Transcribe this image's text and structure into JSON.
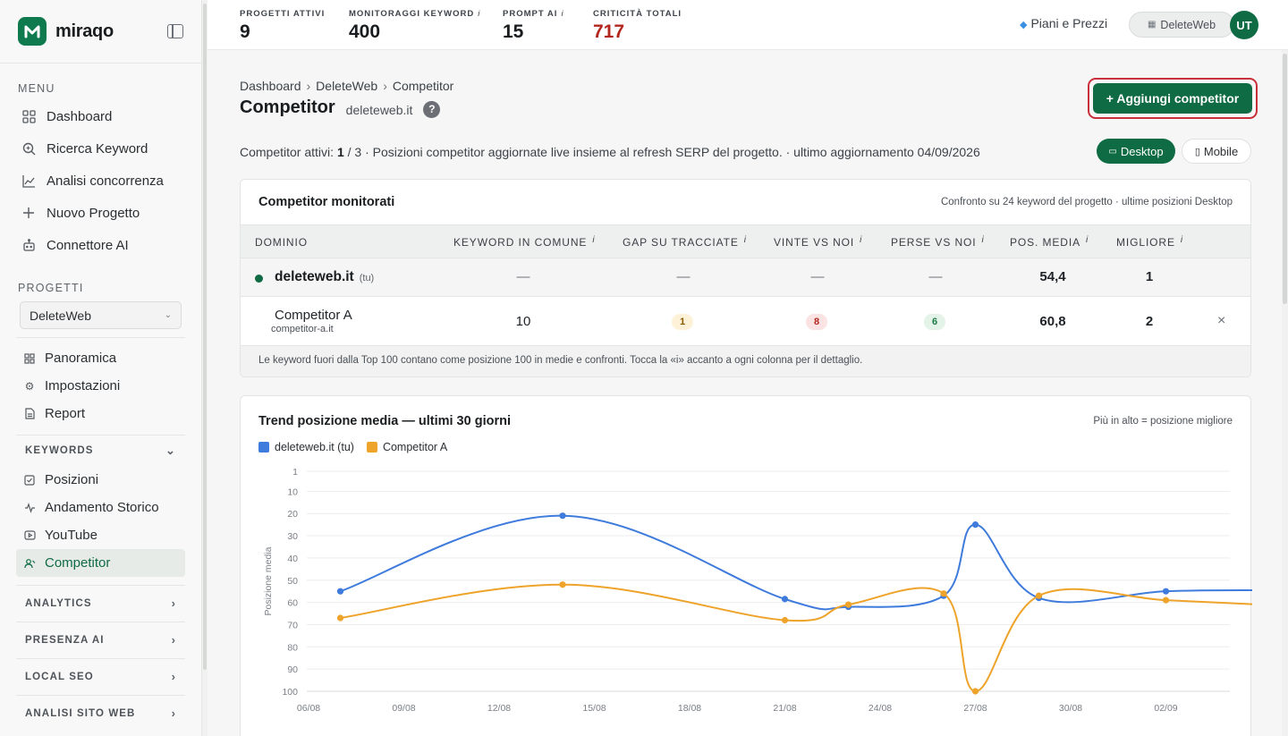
{
  "brand": {
    "name": "miraqo",
    "logo_letter": "M"
  },
  "sidebar": {
    "menu_label": "MENU",
    "menu_items": [
      {
        "label": "Dashboard",
        "icon": "grid-icon"
      },
      {
        "label": "Ricerca Keyword",
        "icon": "search-icon"
      },
      {
        "label": "Analisi concorrenza",
        "icon": "trend-icon"
      },
      {
        "label": "Nuovo Progetto",
        "icon": "plus-icon"
      },
      {
        "label": "Connettore AI",
        "icon": "robot-icon"
      }
    ],
    "projects_label": "PROGETTI",
    "project_select": "DeleteWeb",
    "project_items": [
      {
        "label": "Panoramica",
        "icon": "grid-small-icon"
      },
      {
        "label": "Impostazioni",
        "icon": "gear-icon"
      },
      {
        "label": "Report",
        "icon": "document-icon"
      }
    ],
    "keywords_group": "KEYWORDS",
    "keyword_items": [
      {
        "label": "Posizioni",
        "icon": "checkbox-icon"
      },
      {
        "label": "Andamento Storico",
        "icon": "pulse-icon"
      },
      {
        "label": "YouTube",
        "icon": "youtube-icon"
      },
      {
        "label": "Competitor",
        "icon": "users-icon",
        "active": true
      }
    ],
    "groups": [
      "ANALYTICS",
      "PRESENZA AI",
      "LOCAL SEO",
      "ANALISI SITO WEB"
    ]
  },
  "topbar": {
    "stats": [
      {
        "label": "PROGETTI ATTIVI",
        "value": "9",
        "info": false
      },
      {
        "label": "MONITORAGGI KEYWORD",
        "value": "400",
        "info": true
      },
      {
        "label": "PROMPT AI",
        "value": "15",
        "info": true
      },
      {
        "label": "CRITICITÀ TOTALI",
        "value": "717",
        "info": false
      }
    ],
    "info_glyph": "i",
    "pricing": "Piani e Prezzi",
    "workspace": "DeleteWeb",
    "avatar": "UT"
  },
  "page": {
    "breadcrumb": [
      "Dashboard",
      "DeleteWeb",
      "Competitor"
    ],
    "title": "Competitor",
    "domain": "deleteweb.it",
    "help": "?",
    "add_button": "+ Aggiungi competitor",
    "info_prefix": "Competitor attivi: ",
    "info_active": "1",
    "info_suffix": " / 3 · Posizioni competitor aggiornate live insieme al refresh SERP del progetto. · ultimo aggiornamento 04/09/2026",
    "device_desktop": "Desktop",
    "device_mobile": "Mobile"
  },
  "table": {
    "title": "Competitor monitorati",
    "note": "Confronto su 24 keyword del progetto · ultime posizioni Desktop",
    "headers": [
      "DOMINIO",
      "KEYWORD IN COMUNE",
      "GAP SU TRACCIATE",
      "VINTE VS NOI",
      "PERSE VS NOI",
      "POS. MEDIA",
      "MIGLIORE"
    ],
    "own_row": {
      "domain": "deleteweb.it",
      "tag": "(tu)",
      "common": "—",
      "gap": "—",
      "won": "—",
      "lost": "—",
      "avg": "54,4",
      "best": "1"
    },
    "competitor_row": {
      "name": "Competitor A",
      "domain": "competitor-a.it",
      "common": "10",
      "gap": "1",
      "won": "8",
      "lost": "6",
      "avg": "60,8",
      "best": "2"
    },
    "footnote": "Le keyword fuori dalla Top 100 contano come posizione 100 in medie e confronti. Tocca la «i» accanto a ogni colonna per il dettaglio."
  },
  "trend": {
    "title": "Trend posizione media — ultimi 30 giorni",
    "note": "Più in alto = posizione migliore"
  },
  "chart_data": {
    "type": "line",
    "ylabel": "Posizione media",
    "ylim": [
      1,
      100
    ],
    "y_inverted": true,
    "y_ticks": [
      1,
      10,
      20,
      30,
      40,
      50,
      60,
      70,
      80,
      90,
      100
    ],
    "x_ticks": [
      "06/08",
      "09/08",
      "12/08",
      "15/08",
      "18/08",
      "21/08",
      "24/08",
      "27/08",
      "30/08",
      "02/09"
    ],
    "grid": true,
    "legend": "top-left",
    "series": [
      {
        "name": "deleteweb.it (tu)",
        "color": "#3f7bdc",
        "x": [
          "07/08",
          "14/08",
          "21/08",
          "23/08",
          "26/08",
          "27/08",
          "29/08",
          "02/09",
          "05/09"
        ],
        "values": [
          55,
          21,
          58.5,
          62,
          57,
          25,
          58,
          55,
          54.5
        ]
      },
      {
        "name": "Competitor A",
        "color": "#eea32a",
        "x": [
          "07/08",
          "14/08",
          "21/08",
          "23/08",
          "26/08",
          "27/08",
          "29/08",
          "02/09",
          "05/09"
        ],
        "values": [
          67,
          52,
          68,
          61,
          56,
          100,
          57,
          59,
          61
        ]
      }
    ]
  }
}
